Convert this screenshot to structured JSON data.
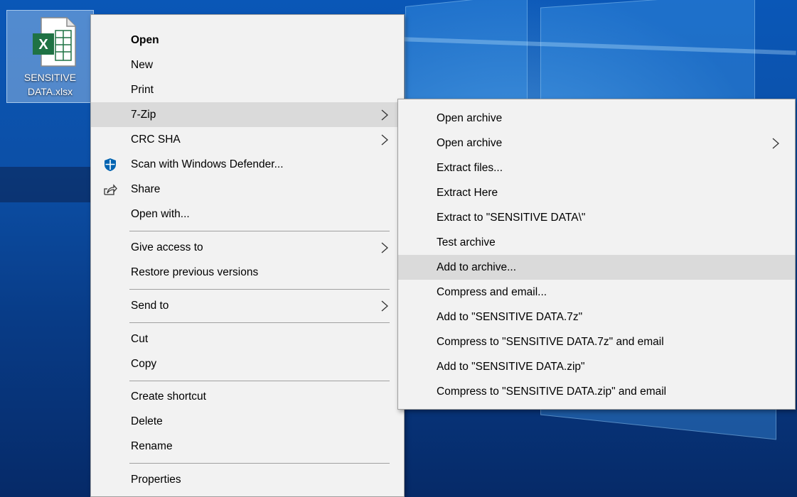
{
  "desktop": {
    "icon_label_line1": "SENSITIVE",
    "icon_label_line2": "DATA.xlsx",
    "icon_badge": "X"
  },
  "context_menu": {
    "items": [
      {
        "label": "Open"
      },
      {
        "label": "New"
      },
      {
        "label": "Print"
      },
      {
        "label": "7-Zip"
      },
      {
        "label": "CRC SHA"
      },
      {
        "label": "Scan with Windows Defender..."
      },
      {
        "label": "Share"
      },
      {
        "label": "Open with..."
      },
      {
        "label": "Give access to"
      },
      {
        "label": "Restore previous versions"
      },
      {
        "label": "Send to"
      },
      {
        "label": "Cut"
      },
      {
        "label": "Copy"
      },
      {
        "label": "Create shortcut"
      },
      {
        "label": "Delete"
      },
      {
        "label": "Rename"
      },
      {
        "label": "Properties"
      }
    ]
  },
  "submenu_7zip": {
    "items": [
      {
        "label": "Open archive"
      },
      {
        "label": "Open archive"
      },
      {
        "label": "Extract files..."
      },
      {
        "label": "Extract Here"
      },
      {
        "label": "Extract to \"SENSITIVE DATA\\\""
      },
      {
        "label": "Test archive"
      },
      {
        "label": "Add to archive..."
      },
      {
        "label": "Compress and email..."
      },
      {
        "label": "Add to \"SENSITIVE DATA.7z\""
      },
      {
        "label": "Compress to \"SENSITIVE DATA.7z\" and email"
      },
      {
        "label": "Add to \"SENSITIVE DATA.zip\""
      },
      {
        "label": "Compress to \"SENSITIVE DATA.zip\" and email"
      }
    ]
  },
  "colors": {
    "menu_bg": "#f2f2f2",
    "highlight": "#dadada",
    "excel_green": "#1f7244",
    "defender_blue": "#0063b1"
  }
}
